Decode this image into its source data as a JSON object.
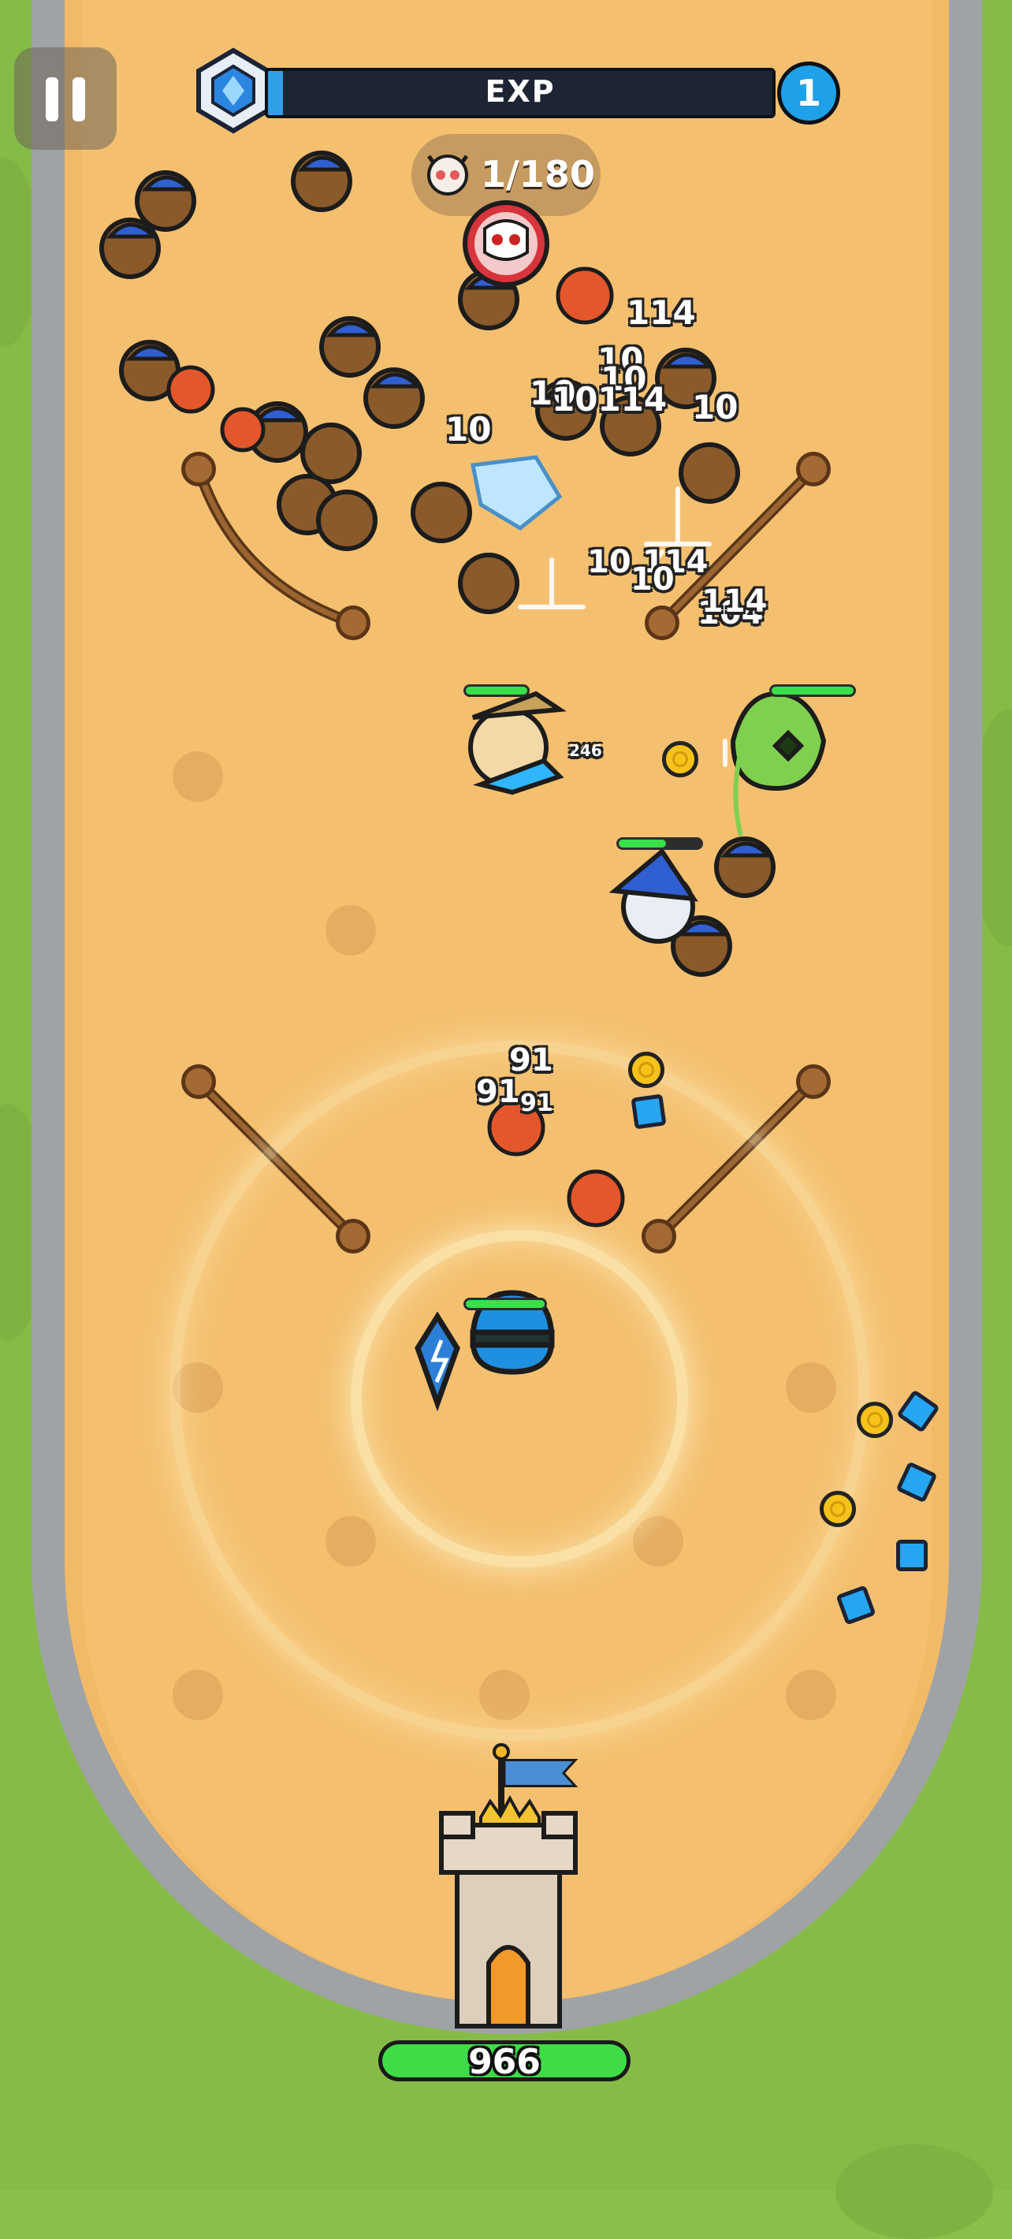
{
  "hud": {
    "exp_label": "EXP",
    "exp_progress": 0.03,
    "level": "1",
    "kills": "1/180",
    "pause_icon": "pause-icon"
  },
  "base": {
    "hp": "966",
    "hp_fraction": 1.0
  },
  "damage_numbers": [
    {
      "text": "114"
    },
    {
      "text": "10"
    },
    {
      "text": "10"
    },
    {
      "text": "10"
    },
    {
      "text": "10"
    },
    {
      "text": "10114"
    },
    {
      "text": "10"
    },
    {
      "text": "10"
    },
    {
      "text": "104"
    },
    {
      "text": "114"
    },
    {
      "text": "10"
    },
    {
      "text": "114"
    },
    {
      "text": "246"
    },
    {
      "text": "91"
    },
    {
      "text": "91"
    },
    {
      "text": "91"
    }
  ],
  "colors": {
    "sand": "#f4c070",
    "track": "#9fa3a6",
    "grass": "#86bb48",
    "exp_fill": "#2fa0e6",
    "hp_green": "#39e04a"
  }
}
